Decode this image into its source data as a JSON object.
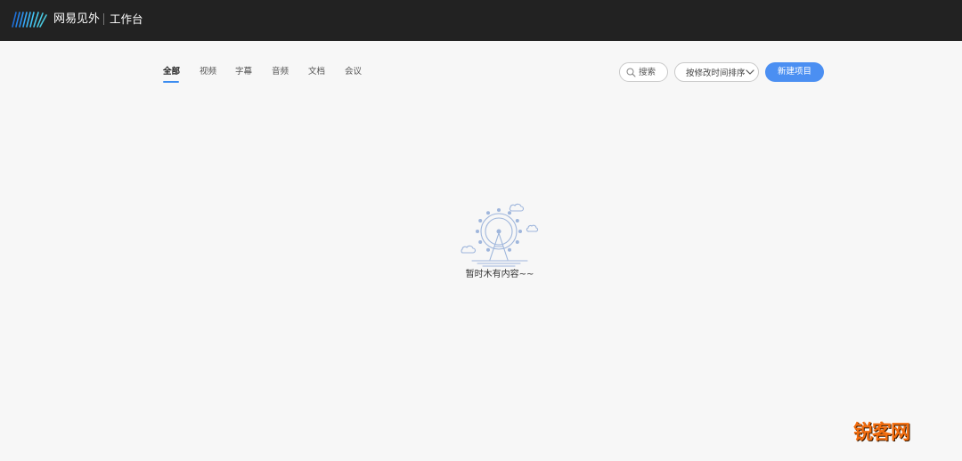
{
  "header": {
    "brand_name": "网易见外",
    "brand_sub": "工作台"
  },
  "tabs": [
    {
      "label": "全部",
      "active": true
    },
    {
      "label": "视频",
      "active": false
    },
    {
      "label": "字幕",
      "active": false
    },
    {
      "label": "音频",
      "active": false
    },
    {
      "label": "文档",
      "active": false
    },
    {
      "label": "会议",
      "active": false
    }
  ],
  "toolbar": {
    "search_label": "搜索",
    "sort_label": "按修改时间排序",
    "new_project_label": "新建项目"
  },
  "empty_state": {
    "message": "暂时木有内容~~"
  },
  "watermark": {
    "text": "锐客网"
  },
  "colors": {
    "topbar": "#222222",
    "accent": "#4b8ff2",
    "background": "#f7f7f7",
    "watermark": "#f26d0f"
  }
}
